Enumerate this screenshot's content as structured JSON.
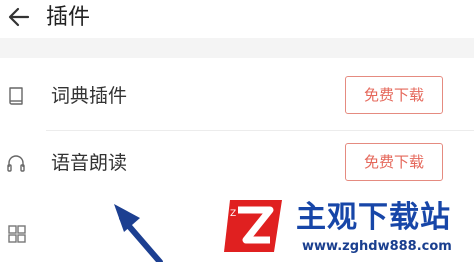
{
  "header": {
    "back_icon": "back-arrow-icon",
    "title": "插件"
  },
  "plugins": [
    {
      "icon": "book-icon",
      "label": "词典插件",
      "action_label": "免费下载"
    },
    {
      "icon": "headphones-icon",
      "label": "语音朗读",
      "action_label": "免费下载"
    },
    {
      "icon": "grid-icon"
    }
  ],
  "colors": {
    "accent": "#e5685b",
    "accent_border": "#e58b80",
    "section_gap": "#f4f4f4",
    "annotation_arrow": "#1c3f91",
    "watermark_blue": "#1746a8",
    "watermark_red": "#e02020"
  },
  "watermark": {
    "title": "主观下载站",
    "url": "www.zghdw888.com",
    "logo_letter": "Z"
  }
}
